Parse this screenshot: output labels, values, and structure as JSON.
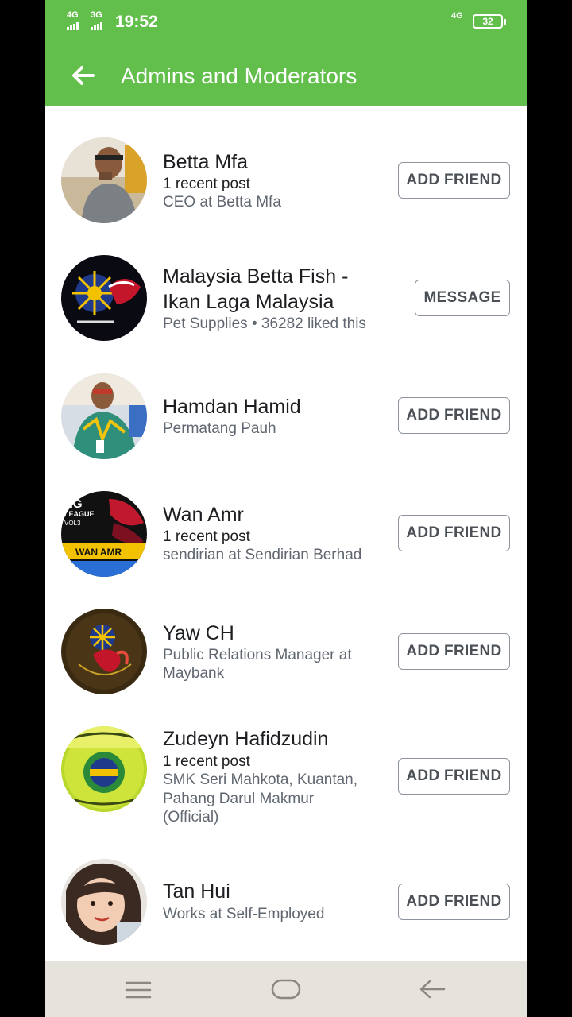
{
  "status_bar": {
    "signal_1": "4G",
    "signal_2": "3G",
    "time": "19:52",
    "network_right": "4G",
    "battery": "32"
  },
  "app_bar": {
    "title": "Admins and Moderators",
    "back_icon": "back-arrow-icon"
  },
  "people": [
    {
      "name": "Betta Mfa",
      "line1": "1 recent post",
      "line2": "CEO at Betta Mfa",
      "action": "ADD FRIEND"
    },
    {
      "name_line1": "Malaysia Betta Fish -",
      "name_line2": "Ikan Laga Malaysia",
      "line1": "Pet Supplies • 36282 liked this",
      "action": "MESSAGE"
    },
    {
      "name": "Hamdan Hamid",
      "line1": "Permatang Pauh",
      "action": "ADD FRIEND"
    },
    {
      "name": "Wan Amr",
      "line1": "1 recent post",
      "line2": "sendirian at Sendirian Berhad",
      "action": "ADD FRIEND",
      "avatar_text": [
        "NG",
        "LEAGUE",
        "VOL3",
        "WAN AMR"
      ]
    },
    {
      "name": "Yaw CH",
      "line1": "Public Relations Manager at",
      "line2": "Maybank",
      "action": "ADD FRIEND"
    },
    {
      "name": "Zudeyn Hafidzudin",
      "line1": "1 recent post",
      "line2": "SMK Seri Mahkota, Kuantan,",
      "line3": "Pahang Darul Makmur",
      "line4": "(Official)",
      "action": "ADD FRIEND"
    },
    {
      "name": "Tan Hui",
      "line1": "Works at Self-Employed",
      "action": "ADD FRIEND"
    }
  ],
  "nav_bar": {
    "menu_icon": "menu-icon",
    "home_icon": "home-icon",
    "back_icon": "back-icon"
  },
  "colors": {
    "accent": "#62bf4b",
    "text": "#1c1e21",
    "secondary_text": "#606770",
    "nav_background": "#e6e3dc"
  }
}
